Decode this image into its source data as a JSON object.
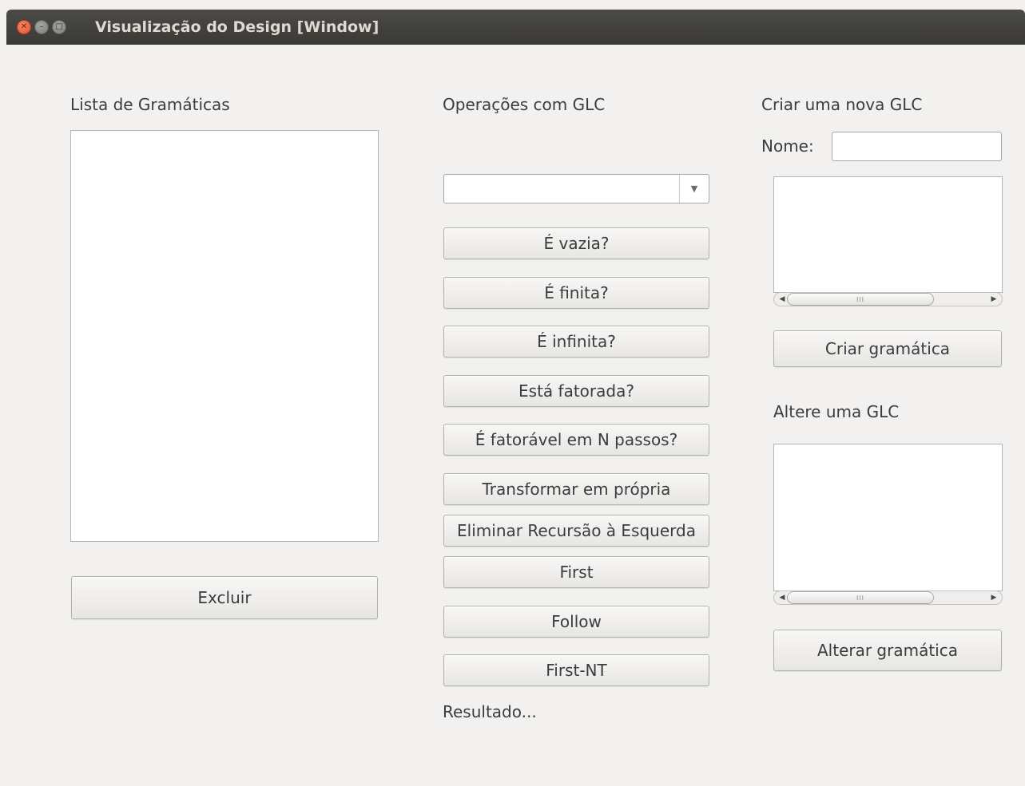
{
  "window": {
    "title": "Visualização do Design [Window]"
  },
  "left": {
    "heading": "Lista de Gramáticas",
    "delete_label": "Excluir"
  },
  "middle": {
    "heading": "Operações com GLC",
    "select_value": "",
    "buttons": [
      "É vazia?",
      "É finita?",
      "É infinita?",
      "Está fatorada?",
      "É fatorável em N passos?",
      "Transformar em própria",
      "Eliminar Recursão à Esquerda",
      "First",
      "Follow",
      "First-NT"
    ],
    "result": "Resultado..."
  },
  "right": {
    "create_heading": "Criar uma nova GLC",
    "name_label": "Nome:",
    "name_value": "",
    "create_label": "Criar gramática",
    "edit_heading": "Altere uma GLC",
    "edit_label": "Alterar gramática",
    "scroll_thumb": "III"
  }
}
